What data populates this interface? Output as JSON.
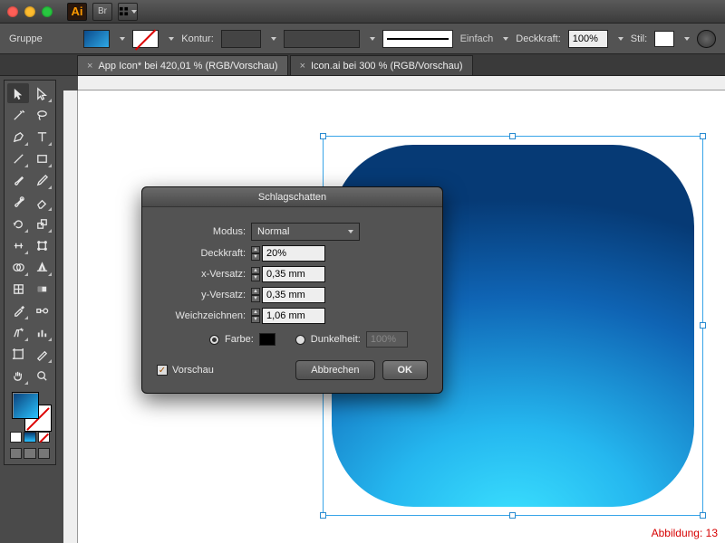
{
  "app": {
    "badge": "Ai",
    "br_label": "Br"
  },
  "optionsbar": {
    "group_label": "Gruppe",
    "kontur_label": "Kontur:",
    "stroke_style_label": "Einfach",
    "deckkraft_label": "Deckkraft:",
    "deckkraft_value": "100%",
    "stil_label": "Stil:"
  },
  "tabs": [
    {
      "label": "App Icon* bei 420,01 % (RGB/Vorschau)",
      "active": true
    },
    {
      "label": "Icon.ai bei 300 % (RGB/Vorschau)",
      "active": false
    }
  ],
  "dialog": {
    "title": "Schlagschatten",
    "mode_label": "Modus:",
    "mode_value": "Normal",
    "opacity_label": "Deckkraft:",
    "opacity_value": "20%",
    "xoff_label": "x-Versatz:",
    "xoff_value": "0,35 mm",
    "yoff_label": "y-Versatz:",
    "yoff_value": "0,35 mm",
    "blur_label": "Weichzeichnen:",
    "blur_value": "1,06 mm",
    "color_label": "Farbe:",
    "darkness_label": "Dunkelheit:",
    "darkness_value": "100%",
    "preview_label": "Vorschau",
    "cancel": "Abbrechen",
    "ok": "OK"
  },
  "figure_caption": "Abbildung: 13"
}
